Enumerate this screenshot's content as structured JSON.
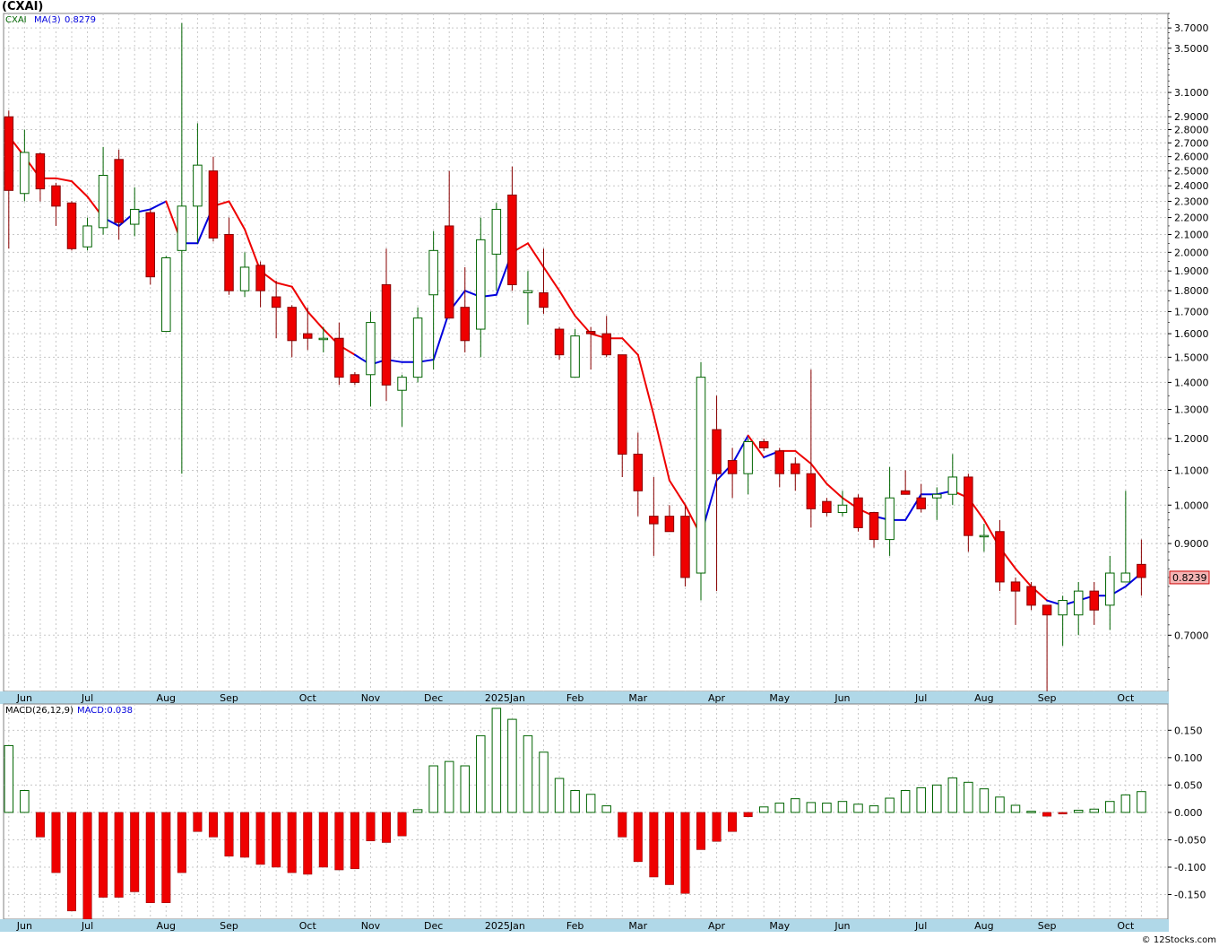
{
  "header": {
    "title": "(CXAI)"
  },
  "legend_price": {
    "symbol": "CXAI",
    "ma_label": "MA(3)",
    "ma_value": "0.8279"
  },
  "legend_macd": {
    "label": "MACD(26,12,9)",
    "value": "MACD:0.038"
  },
  "last_price": "0.8239",
  "footer": "© 12Stocks.com",
  "colors": {
    "down": "#ee0000",
    "up_stroke": "#006400",
    "ma_down": "#ee0000",
    "ma_up": "#0000dd",
    "axis_band": "#b0d8e8",
    "grid": "#c8c8c8",
    "price_box": "#f4b4b4"
  },
  "chart_data": [
    {
      "type": "candlestick",
      "scale": "log",
      "ylim": [
        0.6,
        3.85
      ],
      "y_ticks": [
        "0.7000",
        "0.9000",
        "1.0000",
        "1.1000",
        "1.2000",
        "1.3000",
        "1.4000",
        "1.5000",
        "1.6000",
        "1.7000",
        "1.8000",
        "1.9000",
        "2.0000",
        "2.1000",
        "2.2000",
        "2.3000",
        "2.4000",
        "2.5000",
        "2.6000",
        "2.7000",
        "2.8000",
        "2.9000",
        "3.1000",
        "3.5000",
        "3.7000"
      ],
      "x_month_labels": [
        "Jun",
        "Jul",
        "Aug",
        "Sep",
        "Oct",
        "Nov",
        "Dec",
        "2025Jan",
        "Feb",
        "Mar",
        "Apr",
        "May",
        "Jun",
        "Jul",
        "Aug",
        "Sep",
        "Oct"
      ],
      "candles": [
        {
          "o": 2.9,
          "h": 2.95,
          "l": 2.02,
          "c": 2.37
        },
        {
          "o": 2.35,
          "h": 2.8,
          "l": 2.3,
          "c": 2.63
        },
        {
          "o": 2.62,
          "h": 2.63,
          "l": 2.3,
          "c": 2.38
        },
        {
          "o": 2.4,
          "h": 2.42,
          "l": 2.15,
          "c": 2.27
        },
        {
          "o": 2.29,
          "h": 2.3,
          "l": 2.01,
          "c": 2.02
        },
        {
          "o": 2.03,
          "h": 2.2,
          "l": 2.01,
          "c": 2.15
        },
        {
          "o": 2.14,
          "h": 2.67,
          "l": 2.1,
          "c": 2.47
        },
        {
          "o": 2.58,
          "h": 2.65,
          "l": 2.07,
          "c": 2.17
        },
        {
          "o": 2.16,
          "h": 2.39,
          "l": 2.09,
          "c": 2.25
        },
        {
          "o": 2.23,
          "h": 2.25,
          "l": 1.83,
          "c": 1.87
        },
        {
          "o": 1.61,
          "h": 1.98,
          "l": 1.61,
          "c": 1.97
        },
        {
          "o": 2.01,
          "h": 3.75,
          "l": 1.09,
          "c": 2.27
        },
        {
          "o": 2.27,
          "h": 2.85,
          "l": 2.05,
          "c": 2.54
        },
        {
          "o": 2.5,
          "h": 2.6,
          "l": 2.06,
          "c": 2.08
        },
        {
          "o": 2.1,
          "h": 2.2,
          "l": 1.78,
          "c": 1.8
        },
        {
          "o": 1.8,
          "h": 2.0,
          "l": 1.77,
          "c": 1.92
        },
        {
          "o": 1.93,
          "h": 1.95,
          "l": 1.72,
          "c": 1.8
        },
        {
          "o": 1.77,
          "h": 1.85,
          "l": 1.58,
          "c": 1.72
        },
        {
          "o": 1.72,
          "h": 1.73,
          "l": 1.5,
          "c": 1.57
        },
        {
          "o": 1.6,
          "h": 1.72,
          "l": 1.53,
          "c": 1.58
        },
        {
          "o": 1.58,
          "h": 1.63,
          "l": 1.52,
          "c": 1.58
        },
        {
          "o": 1.58,
          "h": 1.65,
          "l": 1.39,
          "c": 1.42
        },
        {
          "o": 1.43,
          "h": 1.44,
          "l": 1.39,
          "c": 1.4
        },
        {
          "o": 1.43,
          "h": 1.7,
          "l": 1.31,
          "c": 1.65
        },
        {
          "o": 1.83,
          "h": 2.02,
          "l": 1.33,
          "c": 1.39
        },
        {
          "o": 1.37,
          "h": 1.43,
          "l": 1.24,
          "c": 1.42
        },
        {
          "o": 1.42,
          "h": 1.72,
          "l": 1.4,
          "c": 1.67
        },
        {
          "o": 1.78,
          "h": 2.12,
          "l": 1.45,
          "c": 2.01
        },
        {
          "o": 2.15,
          "h": 2.5,
          "l": 1.67,
          "c": 1.67
        },
        {
          "o": 1.72,
          "h": 1.92,
          "l": 1.52,
          "c": 1.57
        },
        {
          "o": 1.62,
          "h": 2.2,
          "l": 1.5,
          "c": 2.07
        },
        {
          "o": 1.99,
          "h": 2.29,
          "l": 1.8,
          "c": 2.25
        },
        {
          "o": 2.34,
          "h": 2.53,
          "l": 1.8,
          "c": 1.83
        },
        {
          "o": 1.79,
          "h": 1.9,
          "l": 1.64,
          "c": 1.8
        },
        {
          "o": 1.79,
          "h": 2.02,
          "l": 1.69,
          "c": 1.72
        },
        {
          "o": 1.62,
          "h": 1.63,
          "l": 1.49,
          "c": 1.51
        },
        {
          "o": 1.42,
          "h": 1.62,
          "l": 1.42,
          "c": 1.59
        },
        {
          "o": 1.61,
          "h": 1.63,
          "l": 1.45,
          "c": 1.6
        },
        {
          "o": 1.6,
          "h": 1.68,
          "l": 1.5,
          "c": 1.51
        },
        {
          "o": 1.51,
          "h": 1.51,
          "l": 1.08,
          "c": 1.15
        },
        {
          "o": 1.15,
          "h": 1.22,
          "l": 0.97,
          "c": 1.04
        },
        {
          "o": 0.97,
          "h": 1.08,
          "l": 0.87,
          "c": 0.95
        },
        {
          "o": 0.97,
          "h": 1.0,
          "l": 0.93,
          "c": 0.93
        },
        {
          "o": 0.97,
          "h": 1.0,
          "l": 0.8,
          "c": 0.82
        },
        {
          "o": 0.83,
          "h": 1.48,
          "l": 0.77,
          "c": 1.42
        },
        {
          "o": 1.23,
          "h": 1.35,
          "l": 0.79,
          "c": 1.09
        },
        {
          "o": 1.13,
          "h": 1.17,
          "l": 1.02,
          "c": 1.09
        },
        {
          "o": 1.09,
          "h": 1.2,
          "l": 1.03,
          "c": 1.19
        },
        {
          "o": 1.19,
          "h": 1.2,
          "l": 1.16,
          "c": 1.17
        },
        {
          "o": 1.16,
          "h": 1.17,
          "l": 1.05,
          "c": 1.09
        },
        {
          "o": 1.12,
          "h": 1.14,
          "l": 1.04,
          "c": 1.09
        },
        {
          "o": 1.09,
          "h": 1.45,
          "l": 0.94,
          "c": 0.99
        },
        {
          "o": 1.01,
          "h": 1.02,
          "l": 0.97,
          "c": 0.98
        },
        {
          "o": 0.98,
          "h": 1.04,
          "l": 0.97,
          "c": 1.0
        },
        {
          "o": 1.02,
          "h": 1.03,
          "l": 0.93,
          "c": 0.94
        },
        {
          "o": 0.98,
          "h": 0.98,
          "l": 0.89,
          "c": 0.91
        },
        {
          "o": 0.91,
          "h": 1.11,
          "l": 0.87,
          "c": 1.02
        },
        {
          "o": 1.04,
          "h": 1.1,
          "l": 1.03,
          "c": 1.03
        },
        {
          "o": 1.02,
          "h": 1.06,
          "l": 0.98,
          "c": 0.99
        },
        {
          "o": 1.02,
          "h": 1.05,
          "l": 0.96,
          "c": 1.03
        },
        {
          "o": 1.03,
          "h": 1.15,
          "l": 1.0,
          "c": 1.08
        },
        {
          "o": 1.08,
          "h": 1.09,
          "l": 0.88,
          "c": 0.92
        },
        {
          "o": 0.92,
          "h": 0.95,
          "l": 0.88,
          "c": 0.92
        },
        {
          "o": 0.93,
          "h": 0.96,
          "l": 0.79,
          "c": 0.81
        },
        {
          "o": 0.81,
          "h": 0.82,
          "l": 0.72,
          "c": 0.79
        },
        {
          "o": 0.8,
          "h": 0.81,
          "l": 0.75,
          "c": 0.76
        },
        {
          "o": 0.76,
          "h": 0.76,
          "l": 0.6,
          "c": 0.74
        },
        {
          "o": 0.74,
          "h": 0.78,
          "l": 0.68,
          "c": 0.77
        },
        {
          "o": 0.74,
          "h": 0.81,
          "l": 0.7,
          "c": 0.79
        },
        {
          "o": 0.79,
          "h": 0.81,
          "l": 0.72,
          "c": 0.75
        },
        {
          "o": 0.76,
          "h": 0.87,
          "l": 0.71,
          "c": 0.83
        },
        {
          "o": 0.81,
          "h": 1.04,
          "l": 0.81,
          "c": 0.83
        },
        {
          "o": 0.85,
          "h": 0.91,
          "l": 0.78,
          "c": 0.82
        }
      ],
      "ma3": [
        2.75,
        2.6,
        2.45,
        2.45,
        2.43,
        2.33,
        2.2,
        2.15,
        2.23,
        2.25,
        2.3,
        2.05,
        2.05,
        2.27,
        2.3,
        2.13,
        1.9,
        1.84,
        1.82,
        1.7,
        1.62,
        1.55,
        1.51,
        1.47,
        1.49,
        1.48,
        1.48,
        1.49,
        1.7,
        1.8,
        1.77,
        1.78,
        2.0,
        2.05,
        1.92,
        1.8,
        1.68,
        1.6,
        1.58,
        1.58,
        1.51,
        1.28,
        1.07,
        1.0,
        0.92,
        1.07,
        1.12,
        1.21,
        1.14,
        1.16,
        1.16,
        1.12,
        1.06,
        1.02,
        0.99,
        0.97,
        0.96,
        0.96,
        1.03,
        1.03,
        1.04,
        1.02,
        0.96,
        0.89,
        0.84,
        0.8,
        0.77,
        0.76,
        0.77,
        0.78,
        0.78,
        0.8,
        0.83
      ],
      "ma3_color": [
        "d",
        "d",
        "d",
        "d",
        "d",
        "d",
        "u",
        "u",
        "u",
        "u",
        "d",
        "u",
        "u",
        "d",
        "d",
        "d",
        "d",
        "d",
        "d",
        "d",
        "d",
        "d",
        "u",
        "u",
        "u",
        "u",
        "u",
        "u",
        "u",
        "u",
        "u",
        "u",
        "d",
        "d",
        "d",
        "d",
        "d",
        "d",
        "d",
        "d",
        "d",
        "d",
        "d",
        "d",
        "u",
        "u",
        "u",
        "d",
        "u",
        "d",
        "d",
        "d",
        "d",
        "d",
        "d",
        "u",
        "u",
        "u",
        "u",
        "u",
        "d",
        "d",
        "d",
        "d",
        "d",
        "d",
        "u",
        "u",
        "u",
        "u",
        "u",
        "u",
        "u"
      ]
    },
    {
      "type": "bar",
      "name": "MACD(26,12,9)",
      "ylim": [
        -0.195,
        0.198
      ],
      "y_ticks": [
        "0.150",
        "0.100",
        "0.050",
        "0.000",
        "-0.050",
        "-0.100",
        "-0.150"
      ],
      "values": [
        0.122,
        0.04,
        -0.045,
        -0.11,
        -0.18,
        -0.195,
        -0.155,
        -0.155,
        -0.145,
        -0.165,
        -0.165,
        -0.11,
        -0.035,
        -0.045,
        -0.08,
        -0.082,
        -0.095,
        -0.1,
        -0.11,
        -0.113,
        -0.1,
        -0.105,
        -0.103,
        -0.052,
        -0.055,
        -0.043,
        0.005,
        0.085,
        0.093,
        0.085,
        0.14,
        0.19,
        0.17,
        0.14,
        0.11,
        0.062,
        0.04,
        0.033,
        0.012,
        -0.045,
        -0.09,
        -0.118,
        -0.132,
        -0.148,
        -0.068,
        -0.053,
        -0.035,
        -0.008,
        0.01,
        0.017,
        0.025,
        0.018,
        0.017,
        0.02,
        0.015,
        0.012,
        0.026,
        0.04,
        0.045,
        0.05,
        0.063,
        0.055,
        0.043,
        0.028,
        0.013,
        0.002,
        -0.007,
        -0.003,
        0.004,
        0.006,
        0.02,
        0.032,
        0.038
      ]
    }
  ]
}
